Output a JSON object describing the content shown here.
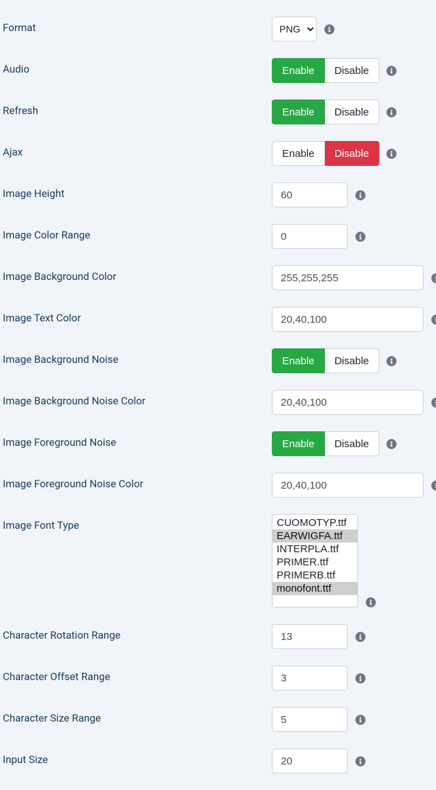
{
  "labels": {
    "format": "Format",
    "audio": "Audio",
    "refresh": "Refresh",
    "ajax": "Ajax",
    "imageHeight": "Image Height",
    "imageColorRange": "Image Color Range",
    "imageBgColor": "Image Background Color",
    "imageTextColor": "Image Text Color",
    "imageBgNoise": "Image Background Noise",
    "imageBgNoiseColor": "Image Background Noise Color",
    "imageFgNoise": "Image Foreground Noise",
    "imageFgNoiseColor": "Image Foreground Noise Color",
    "imageFontType": "Image Font Type",
    "charRotRange": "Character Rotation Range",
    "charOffsetRange": "Character Offset Range",
    "charSizeRange": "Character Size Range",
    "inputSize": "Input Size"
  },
  "toggle": {
    "enable": "Enable",
    "disable": "Disable"
  },
  "format": {
    "selected": "PNG"
  },
  "values": {
    "imageHeight": "60",
    "imageColorRange": "0",
    "imageBgColor": "255,255,255",
    "imageTextColor": "20,40,100",
    "imageBgNoiseColor": "20,40,100",
    "imageFgNoiseColor": "20,40,100",
    "charRotRange": "13",
    "charOffsetRange": "3",
    "charSizeRange": "5",
    "inputSize": "20"
  },
  "toggles": {
    "audio": "enable",
    "refresh": "enable",
    "ajax": "disable",
    "imageBgNoise": "enable",
    "imageFgNoise": "enable"
  },
  "fonts": {
    "options": [
      "CUOMOTYP.ttf",
      "EARWIGFA.ttf",
      "INTERPLA.ttf",
      "PRIMER.ttf",
      "PRIMERB.ttf",
      "monofont.ttf"
    ],
    "selected": [
      "EARWIGFA.ttf",
      "monofont.ttf"
    ]
  }
}
